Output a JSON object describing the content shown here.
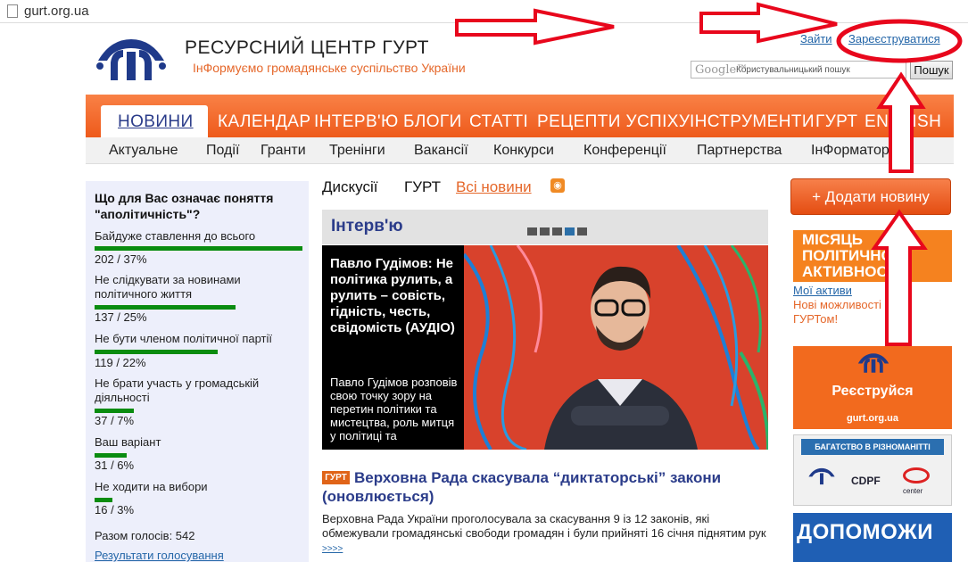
{
  "browser": {
    "url": "gurt.org.ua"
  },
  "header": {
    "title": "РЕСУРСНИЙ ЦЕНТР ГУРТ",
    "subtitle": "ІнФормуємо громадянське суспільство України",
    "login": "Зайти",
    "register": "Зареєструватися",
    "search_brand": "Google™",
    "search_placeholder": "Користувальницький пошук",
    "search_button": "Пошук"
  },
  "nav": {
    "items": [
      "НОВИНИ",
      "КАЛЕНДАР",
      "ІНТЕРВ'Ю",
      "БЛОГИ",
      "СТАТТІ",
      "РЕЦЕПТИ УСПІХУ",
      "ІНСТРУМЕНТИ",
      "ГУРТ",
      "ENGLISH"
    ]
  },
  "subnav": {
    "items": [
      "Актуальне",
      "Події",
      "Гранти",
      "Тренінги",
      "Вакансії",
      "Конкурси",
      "Конференції",
      "Партнерства",
      "ІнФорматор"
    ]
  },
  "poll": {
    "question": "Що для Вас означає поняття \"аполітичність\"?",
    "options": [
      {
        "label": "Байдуже ставлення до всього",
        "result": "202 / 37%",
        "share": 0.37
      },
      {
        "label": "Не слідкувати за новинами політичного життя",
        "result": "137 / 25%",
        "share": 0.25
      },
      {
        "label": "Не бути членом політичної партії",
        "result": "119 / 22%",
        "share": 0.22
      },
      {
        "label": "Не брати участь у громадській діяльності",
        "result": "37 / 7%",
        "share": 0.07
      },
      {
        "label": "Ваш варіант",
        "result": "31 / 6%",
        "share": 0.06
      },
      {
        "label": "Не ходити на вибори",
        "result": "16 / 3%",
        "share": 0.03
      }
    ],
    "total": "Разом голосів: 542",
    "results_link": "Результати голосування"
  },
  "center": {
    "tab_discussions": "Дискусії",
    "tab_gurt": "ГУРТ",
    "tab_all": "Всі новини",
    "interview_title": "Інтерв'ю",
    "feature_headline": "Павло Гудімов: Не політика рулить, а рулить – совість, гідність, честь, свідомість (АУДІО)",
    "feature_lead": "Павло Гудімов розповів свою точку зору на перетин політики та мистецтва, роль митця у політиці та",
    "news_badge": "ГУРТ",
    "news_title": "Верховна Рада скасувала “диктаторські” закони (оновлюється)",
    "news_body": "Верховна Рада України проголосувала за скасування 9 із 12 законів, які обмежували громадянські свободи громадян і були прийняті 16 січня піднятим рук",
    "news_more": ">>>>"
  },
  "right": {
    "add_news": "+ Додати новину",
    "month_banner": "МІСЯЦЬ ПОЛІТИЧНОЇ АКТИВНОСТІ",
    "my_active": "Мої активи",
    "new_opps": "Нові можливості з ГУРТом!",
    "reg_banner": "Реєструйся",
    "reg_url": "gurt.org.ua",
    "diversity_title": "БАГАТСТВО В РІЗНОМАНІТТІ",
    "diversity_logos": "CDPF",
    "diversity_center": "center",
    "help_banner": "ДОПОМОЖИ"
  },
  "colors": {
    "accent_orange": "#ee5a1b",
    "brand_blue": "#2b3c8a",
    "link_blue": "#2466a8",
    "poll_bar_green": "#0a8c10",
    "annotation_red": "#e8071c"
  }
}
